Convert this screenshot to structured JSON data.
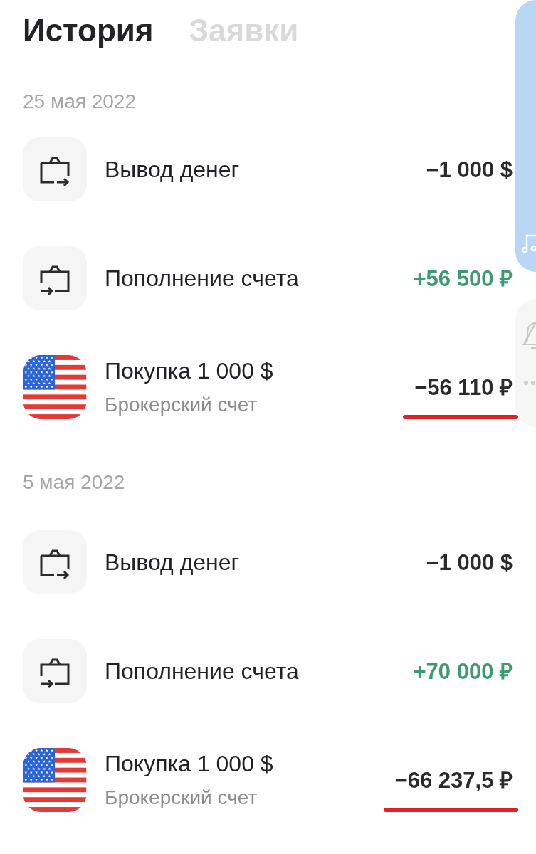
{
  "tabs": [
    {
      "label": "История",
      "selected": true
    },
    {
      "label": "Заявки",
      "selected": false
    }
  ],
  "groups": [
    {
      "date": "25 мая 2022",
      "transactions": [
        {
          "kind": "withdrawal",
          "title": "Вывод денег",
          "amount": "−1 000 $",
          "credit": false,
          "underlined": false
        },
        {
          "kind": "deposit",
          "title": "Пополнение счета",
          "amount": "+56 500 ₽",
          "credit": true,
          "underlined": false
        },
        {
          "kind": "purchase",
          "title": "Покупка 1 000 $",
          "subtitle": "Брокерский счет",
          "amount": "−56 110 ₽",
          "credit": false,
          "underlined": true
        }
      ]
    },
    {
      "date": "5 мая 2022",
      "transactions": [
        {
          "kind": "withdrawal",
          "title": "Вывод денег",
          "amount": "−1 000 $",
          "credit": false,
          "underlined": false
        },
        {
          "kind": "deposit",
          "title": "Пополнение счета",
          "amount": "+70 000 ₽",
          "credit": true,
          "underlined": false
        },
        {
          "kind": "purchase",
          "title": "Покупка 1 000 $",
          "subtitle": "Брокерский счет",
          "amount": "−66 237,5 ₽",
          "credit": false,
          "underlined": true
        }
      ]
    }
  ]
}
